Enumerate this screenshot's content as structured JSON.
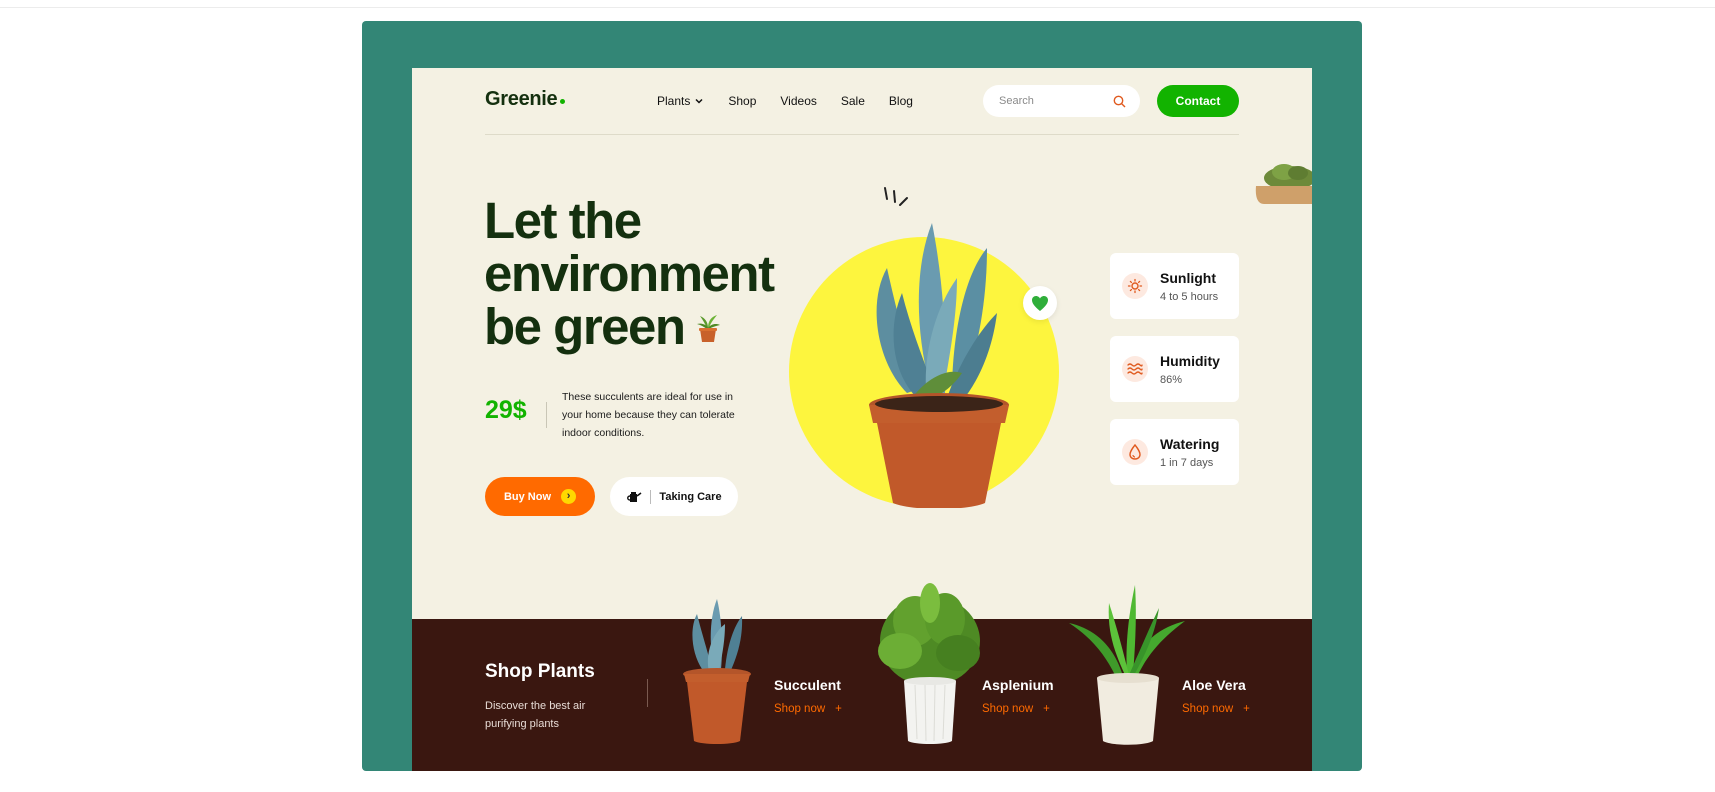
{
  "brand": {
    "name": "Greenie"
  },
  "nav": {
    "items": [
      {
        "label": "Plants"
      },
      {
        "label": "Shop"
      },
      {
        "label": "Videos"
      },
      {
        "label": "Sale"
      },
      {
        "label": "Blog"
      }
    ]
  },
  "search": {
    "placeholder": "Search"
  },
  "contact": {
    "label": "Contact"
  },
  "hero": {
    "headline_line1": "Let the",
    "headline_line2": "environment",
    "headline_line3": "be green",
    "price": "29$",
    "description": "These succulents are ideal for use in your home because they can tolerate indoor conditions.",
    "buy_label": "Buy Now",
    "care_label": "Taking Care"
  },
  "stats": [
    {
      "title": "Sunlight",
      "value": "4 to 5 hours",
      "icon": "sun-icon"
    },
    {
      "title": "Humidity",
      "value": "86%",
      "icon": "waves-icon"
    },
    {
      "title": "Watering",
      "value": "1 in 7 days",
      "icon": "water-drop-icon"
    }
  ],
  "shop": {
    "title": "Shop Plants",
    "subtitle": "Discover the best air purifying plants",
    "products": [
      {
        "name": "Succulent",
        "link": "Shop now",
        "plus": "+"
      },
      {
        "name": "Asplenium",
        "link": "Shop now",
        "plus": "+"
      },
      {
        "name": "Aloe Vera",
        "link": "Shop now",
        "plus": "+"
      }
    ]
  },
  "colors": {
    "frame": "#338676",
    "page_bg": "#f4f1e3",
    "brand_green": "#12b300",
    "accent_orange": "#ff6a00",
    "circle_yellow": "#fdf53e",
    "footer_brown": "#3a1710"
  }
}
